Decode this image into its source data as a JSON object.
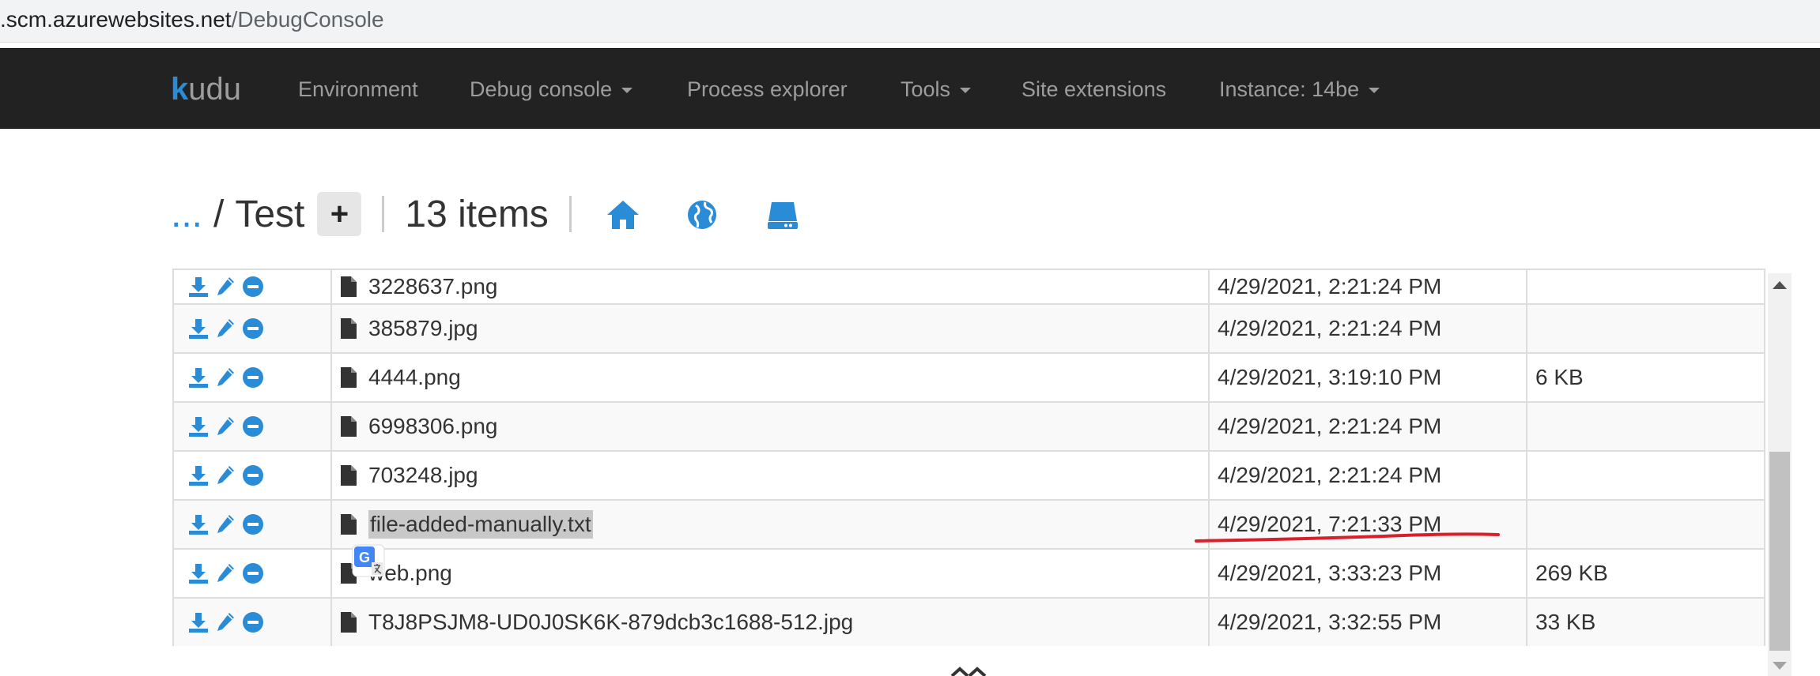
{
  "address_bar": {
    "host": ".scm.azurewebsites.net",
    "path": "/DebugConsole"
  },
  "navbar": {
    "brand": "udu",
    "brand_mark": "k",
    "items": [
      {
        "label": "Environment",
        "dropdown": false
      },
      {
        "label": "Debug console",
        "dropdown": true
      },
      {
        "label": "Process explorer",
        "dropdown": false
      },
      {
        "label": "Tools",
        "dropdown": true
      },
      {
        "label": "Site extensions",
        "dropdown": false
      },
      {
        "label": "Instance: 14be",
        "dropdown": true
      }
    ]
  },
  "breadcrumb": {
    "ellipsis": "...",
    "separator": "/",
    "current_folder": "Test",
    "add_label": "+",
    "item_count": "13 items",
    "icons": [
      "home-icon",
      "globe-icon",
      "drive-icon"
    ]
  },
  "files": {
    "rows": [
      {
        "name": "3228637.png",
        "modified": "4/29/2021, 2:21:24 PM",
        "size": ""
      },
      {
        "name": "385879.jpg",
        "modified": "4/29/2021, 2:21:24 PM",
        "size": ""
      },
      {
        "name": "4444.png",
        "modified": "4/29/2021, 3:19:10 PM",
        "size": "6 KB"
      },
      {
        "name": "6998306.png",
        "modified": "4/29/2021, 2:21:24 PM",
        "size": ""
      },
      {
        "name": "703248.jpg",
        "modified": "4/29/2021, 2:21:24 PM",
        "size": ""
      },
      {
        "name": "file-added-manually.txt",
        "modified": "4/29/2021, 7:21:33 PM",
        "size": "",
        "highlighted": true
      },
      {
        "name": "web.png",
        "modified": "4/29/2021, 3:33:23 PM",
        "size": "269 KB"
      },
      {
        "name": "T8J8PSJM8-UD0J0SK6K-879dcb3c1688-512.jpg",
        "modified": "4/29/2021, 3:32:55 PM",
        "size": "33 KB"
      }
    ],
    "row_icons": [
      "download-icon",
      "edit-icon",
      "delete-icon",
      "file-icon"
    ]
  },
  "colors": {
    "navbar_bg": "#222222",
    "nav_text": "#9d9d9d",
    "accent_blue": "#2a8bd6",
    "annotation_red": "#d9202a"
  }
}
